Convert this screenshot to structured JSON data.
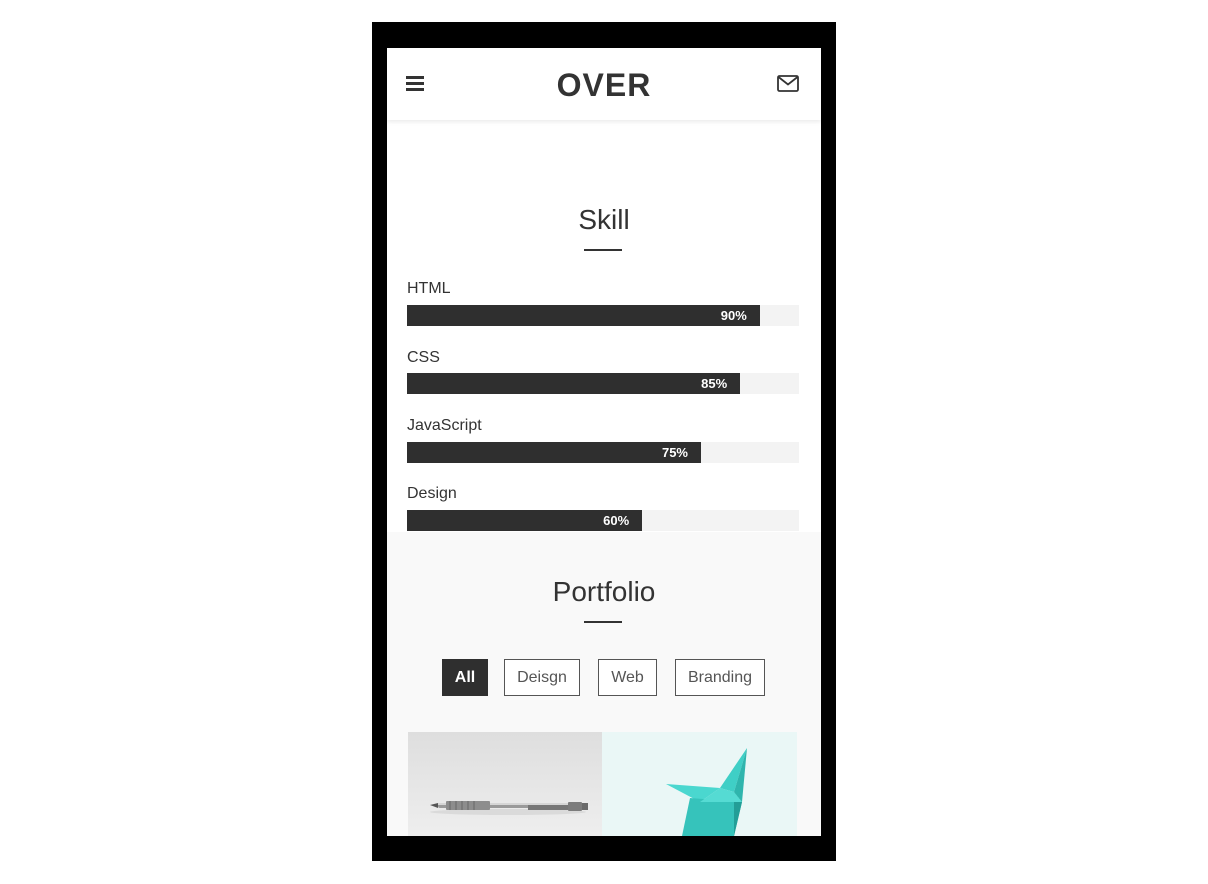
{
  "header": {
    "brand": "OVER",
    "menu_icon": "hamburger-menu-icon",
    "mail_icon": "envelope-icon"
  },
  "skills": {
    "title": "Skill",
    "items": [
      {
        "label": "HTML",
        "percent": 90,
        "percent_text": "90%"
      },
      {
        "label": "CSS",
        "percent": 85,
        "percent_text": "85%"
      },
      {
        "label": "JavaScript",
        "percent": 75,
        "percent_text": "75%"
      },
      {
        "label": "Design",
        "percent": 60,
        "percent_text": "60%"
      }
    ]
  },
  "portfolio": {
    "title": "Portfolio",
    "filters": [
      {
        "label": "All",
        "active": true
      },
      {
        "label": "Deisgn",
        "active": false
      },
      {
        "label": "Web",
        "active": false
      },
      {
        "label": "Branding",
        "active": false
      }
    ]
  },
  "colors": {
    "bar_fill": "#2f2f2f",
    "bar_track": "#f3f3f3",
    "text": "#333333",
    "origami_accent": "#3fcfc6"
  }
}
